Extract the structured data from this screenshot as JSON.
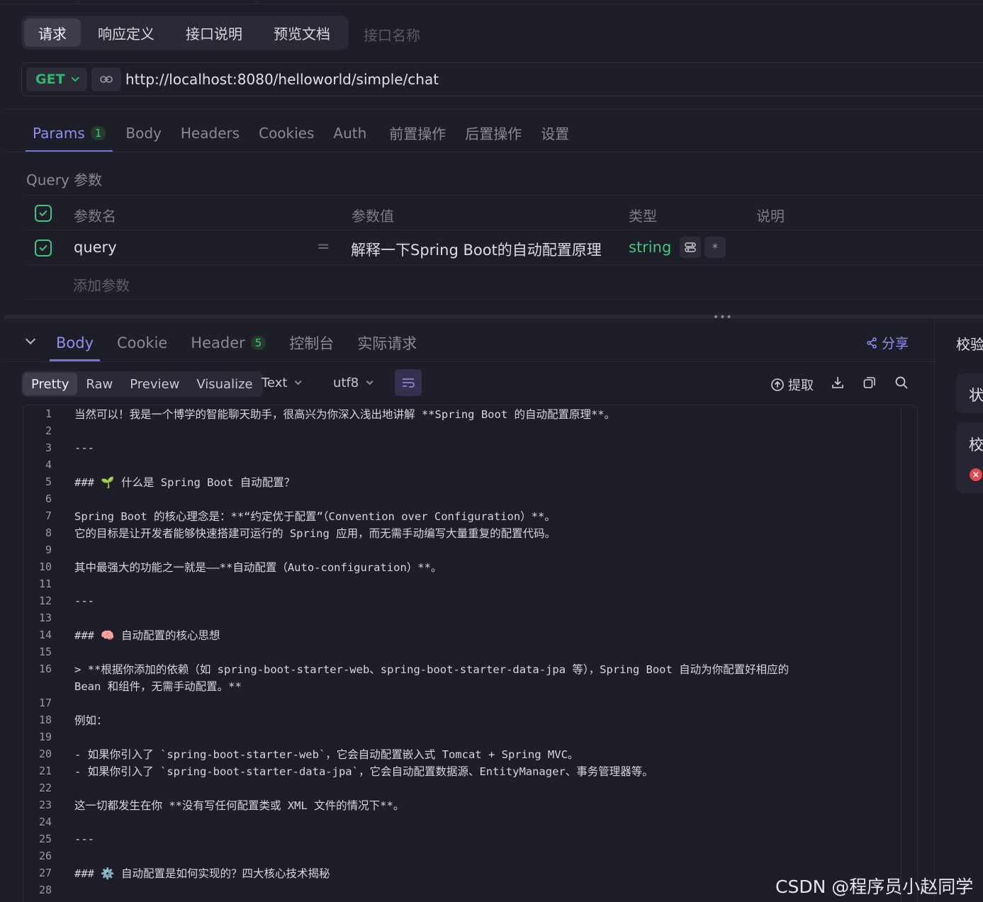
{
  "request_tabs": [
    "请求",
    "响应定义",
    "接口说明",
    "预览文档"
  ],
  "api_name_placeholder": "接口名称",
  "url_bar": {
    "method": "GET",
    "url": "http://localhost:8080/helloworld/simple/chat"
  },
  "param_tabs": [
    {
      "label": "Params",
      "count": "1"
    },
    {
      "label": "Body"
    },
    {
      "label": "Headers"
    },
    {
      "label": "Cookies"
    },
    {
      "label": "Auth"
    },
    {
      "label": "前置操作"
    },
    {
      "label": "后置操作"
    },
    {
      "label": "设置"
    }
  ],
  "query_section": {
    "title": "Query 参数",
    "headers": [
      "参数名",
      "参数值",
      "类型",
      "说明"
    ],
    "row": {
      "name": "query",
      "eq": "=",
      "value": "解释一下Spring Boot的自动配置原理",
      "type": "string",
      "required_mark": "*"
    },
    "add_label": "添加参数"
  },
  "response_tabs": [
    {
      "label": "Body"
    },
    {
      "label": "Cookie"
    },
    {
      "label": "Header",
      "count": "5"
    },
    {
      "label": "控制台"
    },
    {
      "label": "实际请求"
    }
  ],
  "share_label": "分享",
  "right_panel": {
    "title": "校验",
    "card1": "状",
    "card2": "校",
    "error_icon": "×"
  },
  "format_tabs": [
    "Pretty",
    "Raw",
    "Preview",
    "Visualize"
  ],
  "text_mode": "Text",
  "encoding": "utf8",
  "extract_label": "提取",
  "icons": {
    "link": "link-icon",
    "share": "share-icon",
    "wrap": "wrap-lines-icon",
    "extract": "extract-icon",
    "download": "download-icon",
    "copy": "copy-icon",
    "search": "search-icon"
  },
  "colors": {
    "accent": "#7b6fdc",
    "success": "#3fc77b",
    "error": "#e5484d",
    "background": "#1e1e29"
  },
  "code_lines": [
    {
      "n": "1",
      "t": "当然可以！我是一个博学的智能聊天助手，很高兴为你深入浅出地讲解 **Spring Boot 的自动配置原理**。"
    },
    {
      "n": "2",
      "t": ""
    },
    {
      "n": "3",
      "t": "---"
    },
    {
      "n": "4",
      "t": ""
    },
    {
      "n": "5",
      "t": "### 🌱 什么是 Spring Boot 自动配置？"
    },
    {
      "n": "6",
      "t": ""
    },
    {
      "n": "7",
      "t": "Spring Boot 的核心理念是：**“约定优于配置”（Convention over Configuration）**。"
    },
    {
      "n": "8",
      "t": "它的目标是让开发者能够快速搭建可运行的 Spring 应用，而无需手动编写大量重复的配置代码。"
    },
    {
      "n": "9",
      "t": ""
    },
    {
      "n": "10",
      "t": "其中最强大的功能之一就是——**自动配置（Auto-configuration）**。"
    },
    {
      "n": "11",
      "t": ""
    },
    {
      "n": "12",
      "t": "---"
    },
    {
      "n": "13",
      "t": ""
    },
    {
      "n": "14",
      "t": "### 🧠 自动配置的核心思想"
    },
    {
      "n": "15",
      "t": ""
    },
    {
      "n": "16",
      "t": "> **根据你添加的依赖（如 spring-boot-starter-web、spring-boot-starter-data-jpa 等），Spring Boot 自动为你配置好相应的"
    },
    {
      "n": "",
      "t": "Bean 和组件，无需手动配置。**"
    },
    {
      "n": "17",
      "t": ""
    },
    {
      "n": "18",
      "t": "例如："
    },
    {
      "n": "19",
      "t": ""
    },
    {
      "n": "20",
      "t": "- 如果你引入了 `spring-boot-starter-web`，它会自动配置嵌入式 Tomcat + Spring MVC。"
    },
    {
      "n": "21",
      "t": "- 如果你引入了 `spring-boot-starter-data-jpa`，它会自动配置数据源、EntityManager、事务管理器等。"
    },
    {
      "n": "22",
      "t": ""
    },
    {
      "n": "23",
      "t": "这一切都发生在你 **没有写任何配置类或 XML 文件的情况下**。"
    },
    {
      "n": "24",
      "t": ""
    },
    {
      "n": "25",
      "t": "---"
    },
    {
      "n": "26",
      "t": ""
    },
    {
      "n": "27",
      "t": "### ⚙️ 自动配置是如何实现的？四大核心技术揭秘"
    },
    {
      "n": "28",
      "t": ""
    }
  ],
  "watermark": "CSDN @程序员小赵同学"
}
